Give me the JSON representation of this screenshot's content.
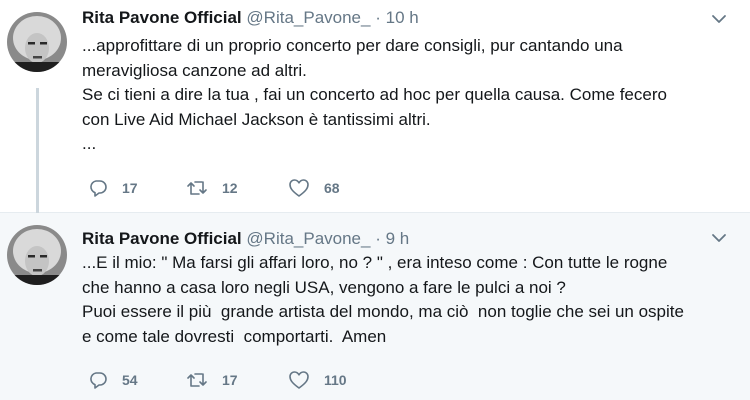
{
  "tweets": [
    {
      "name": "Rita Pavone Official",
      "handle": "@Rita_Pavone_",
      "separator": "·",
      "time": "10 h",
      "lines": [
        "...approfittare di un proprio concerto per dare consigli, pur cantando una",
        "meravigliosa canzone ad altri.",
        "Se ci tieni a dire la tua , fai un concerto ad hoc per quella causa. Come fecero",
        "con Live Aid Michael Jackson è tantissimi altri.",
        "..."
      ],
      "replies": "17",
      "retweets": "12",
      "likes": "68"
    },
    {
      "name": "Rita Pavone Official",
      "handle": "@Rita_Pavone_",
      "separator": "·",
      "time": "9 h",
      "lines": [
        "...E il mio: \" Ma farsi gli affari loro, no ? \" , era inteso come : Con tutte le rogne",
        "che hanno a casa loro negli USA, vengono a fare le pulci a noi ?",
        "Puoi essere il più  grande artista del mondo, ma ciò  non toglie che sei un ospite",
        "e come tale dovresti  comportarti.  Amen"
      ],
      "replies": "54",
      "retweets": "17",
      "likes": "110"
    }
  ],
  "icons": {
    "reply": "reply-icon",
    "retweet": "retweet-icon",
    "like": "heart-icon",
    "more": "chevron-down-icon"
  },
  "colors": {
    "text": "#14171a",
    "secondary": "#657786",
    "thread_line": "#ccd6dd",
    "highlight_bg": "#f5f8fa"
  }
}
